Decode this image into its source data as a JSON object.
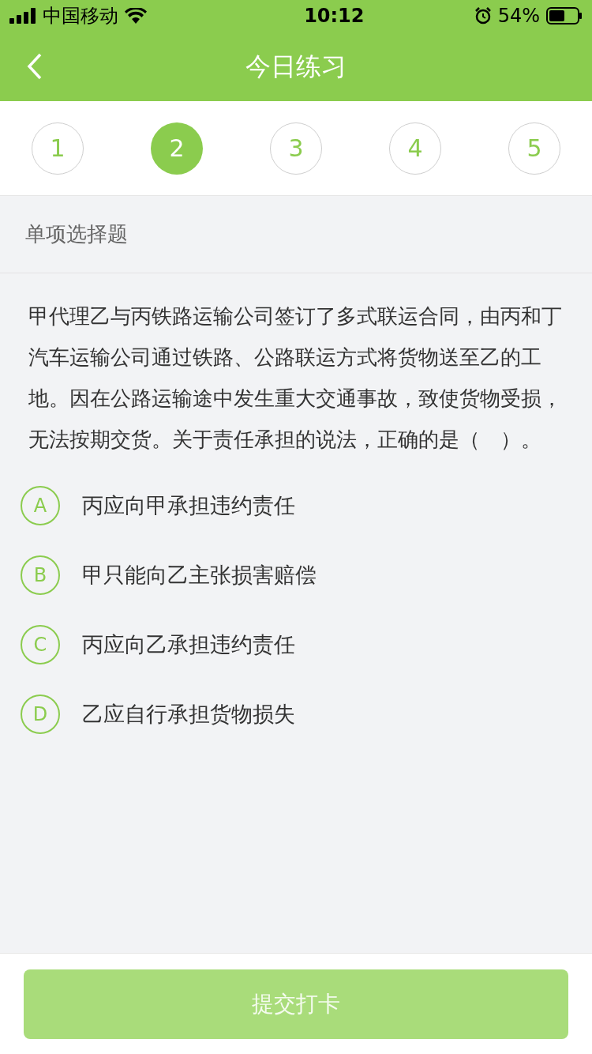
{
  "status_bar": {
    "carrier": "中国移动",
    "time": "10:12",
    "battery": "54%"
  },
  "header": {
    "title": "今日练习"
  },
  "steps": [
    {
      "label": "1",
      "selected": false
    },
    {
      "label": "2",
      "selected": true
    },
    {
      "label": "3",
      "selected": false
    },
    {
      "label": "4",
      "selected": false
    },
    {
      "label": "5",
      "selected": false
    }
  ],
  "question_type": "单项选择题",
  "question": "甲代理乙与丙铁路运输公司签订了多式联运合同，由丙和丁汽车运输公司通过铁路、公路联运方式将货物送至乙的工地。因在公路运输途中发生重大交通事故，致使货物受损，无法按期交货。关于责任承担的说法，正确的是（　）。",
  "options": [
    {
      "letter": "A",
      "text": "丙应向甲承担违约责任",
      "selected": false
    },
    {
      "letter": "B",
      "text": "甲只能向乙主张损害赔偿",
      "selected": false
    },
    {
      "letter": "C",
      "text": "丙应向乙承担违约责任",
      "selected": false
    },
    {
      "letter": "D",
      "text": "乙应自行承担货物损失",
      "selected": false
    }
  ],
  "submit": {
    "label": "提交打卡",
    "disabled": true
  }
}
